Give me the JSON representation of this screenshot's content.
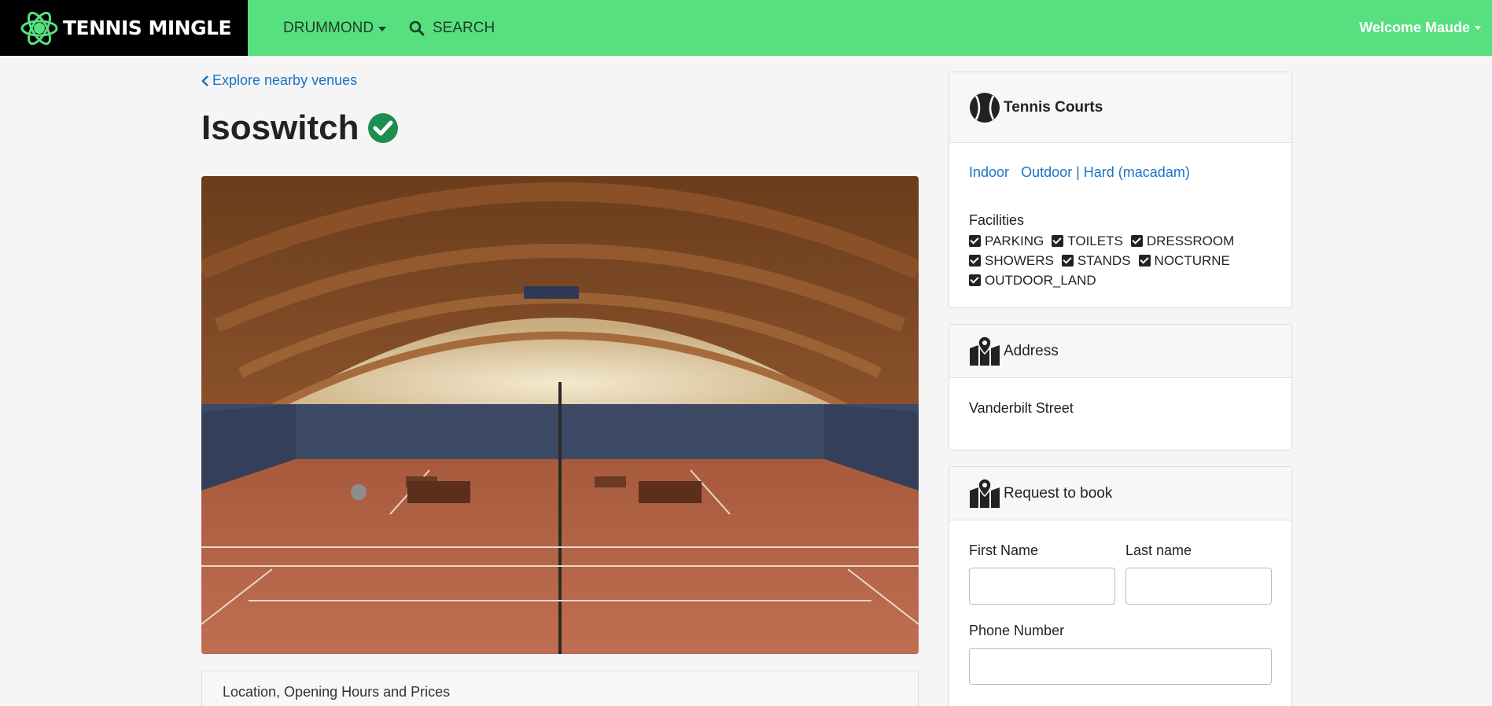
{
  "navbar": {
    "brand": "TENNIS MINGLE",
    "city": "DRUMMOND",
    "search": "SEARCH",
    "user": "Welcome Maude",
    "bg_color": "#57e07f"
  },
  "venue": {
    "back_link": "Explore nearby venues",
    "name": "Isoswitch",
    "verified_color": "#1e8e4e",
    "photo_alt": "Indoor clay tennis courts",
    "info_tab": "Location, Opening Hours and Prices"
  },
  "courts": {
    "title": "Tennis Courts",
    "types": [
      "Indoor",
      "Outdoor | Hard (macadam)"
    ],
    "facilities_label": "Facilities",
    "facilities": [
      "PARKING",
      "TOILETS",
      "DRESSROOM",
      "SHOWERS",
      "STANDS",
      "NOCTURNE",
      "OUTDOOR_LAND"
    ]
  },
  "address": {
    "title": "Address",
    "street": "Vanderbilt Street"
  },
  "booking": {
    "title": "Request to book",
    "first_name_label": "First Name",
    "last_name_label": "Last name",
    "phone_label": "Phone Number",
    "first_name_value": "",
    "last_name_value": "",
    "phone_value": ""
  }
}
